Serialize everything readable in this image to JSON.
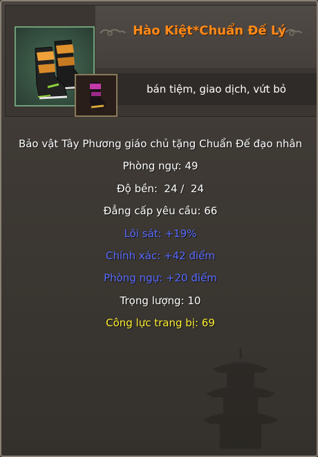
{
  "item": {
    "name": "Hào Kiệt*Chuẩn Đế Lý",
    "actions": "bán tiệm, giao dịch, vứt bỏ",
    "icon": "boots-icon",
    "sub_icon": "boots-small-icon"
  },
  "stats": {
    "description": "Bảo vật Tây Phương giáo chủ tặng Chuẩn Đế đạo nhân",
    "defense": "Phòng ngự: 49",
    "durability": "Độ bền:  24 /  24",
    "level_req": "Đẳng cấp yêu cầu: 66",
    "lightning": "Lôi sát: +19%",
    "accuracy": "Chính xác: +42 điểm",
    "defense_bonus": "Phòng ngự: +20 điểm",
    "weight": "Trọng lượng: 10",
    "power": "Công lực trang bị: 69"
  },
  "colors": {
    "title": "#ff8a1a",
    "normal": "#ffffff",
    "bonus": "#5a6cff",
    "power": "#ffee33"
  }
}
